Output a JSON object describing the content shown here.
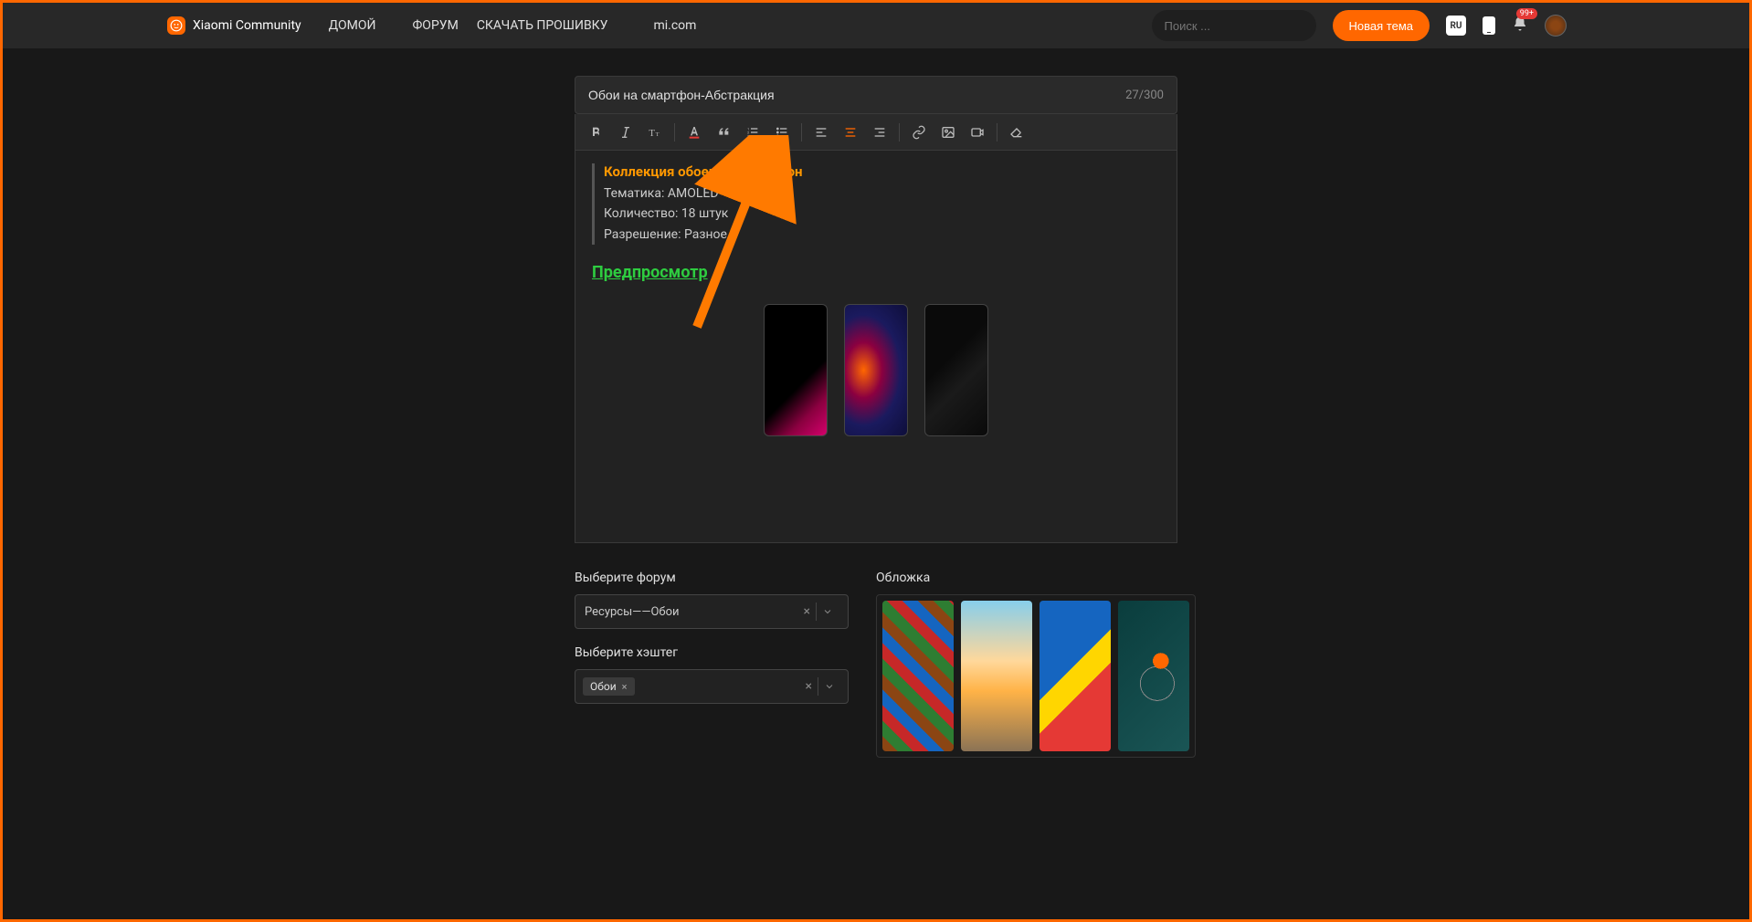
{
  "header": {
    "brand": "Xiaomi Community",
    "nav": [
      "ДОМОЙ",
      "ФОРУМ",
      "СКАЧАТЬ ПРОШИВКУ",
      "mi.com"
    ],
    "search_placeholder": "Поиск ...",
    "new_topic": "Новая тема",
    "lang": "RU",
    "notif_count": "99+"
  },
  "editor": {
    "title_value": "Обои на смартфон-Абстракция",
    "char_count": "27/300",
    "content": {
      "quote_title": "Коллекция обоев на смартфон",
      "lines": [
        "Тематика: AMOLED",
        "Количество: 18 штук",
        "Разрешение: Разное"
      ],
      "preview_heading": "Предпросмотр"
    }
  },
  "form": {
    "forum_label": "Выберите форум",
    "forum_value": "Ресурсы——Обои",
    "hashtag_label": "Выберите хэштег",
    "hashtag_value": "Обои",
    "cover_label": "Обложка"
  }
}
